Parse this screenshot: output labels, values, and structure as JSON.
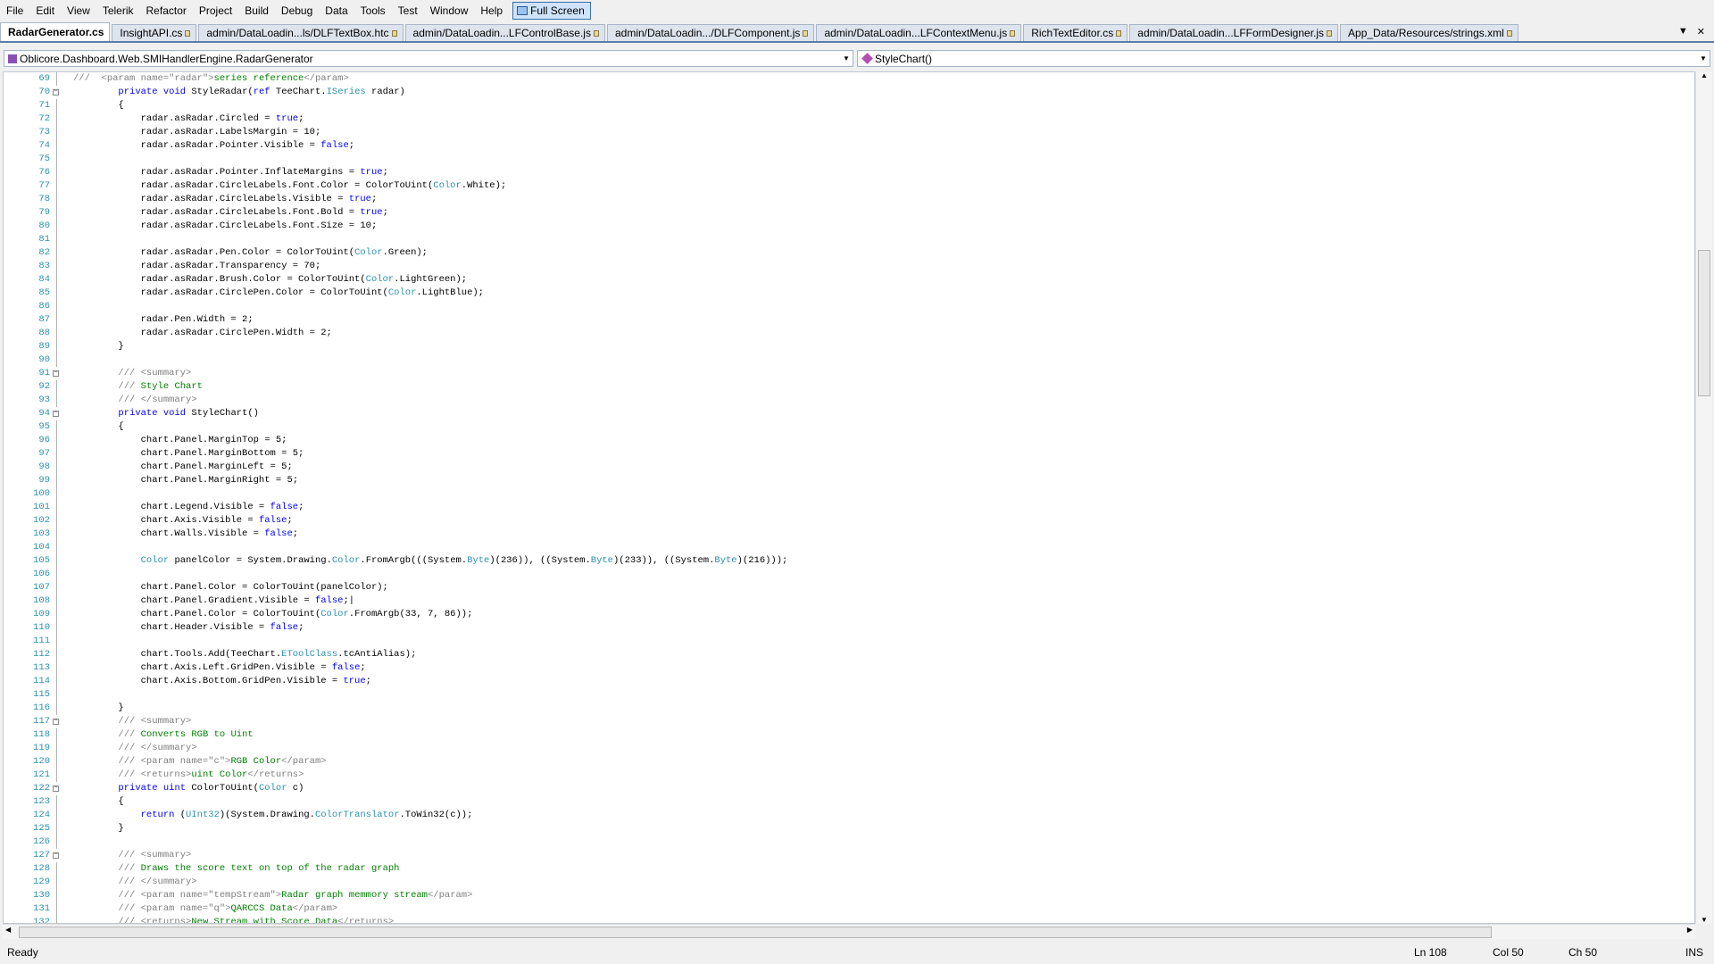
{
  "menu": [
    "File",
    "Edit",
    "View",
    "Telerik",
    "Refactor",
    "Project",
    "Build",
    "Debug",
    "Data",
    "Tools",
    "Test",
    "Window",
    "Help"
  ],
  "full_screen_label": "Full Screen",
  "tabs": [
    "RadarGenerator.cs",
    "InsightAPI.cs",
    "admin/DataLoadin...ls/DLFTextBox.htc",
    "admin/DataLoadin...LFControlBase.js",
    "admin/DataLoadin.../DLFComponent.js",
    "admin/DataLoadin...LFContextMenu.js",
    "RichTextEditor.cs",
    "admin/DataLoadin...LFFormDesigner.js",
    "App_Data/Resources/strings.xml"
  ],
  "active_tab": 0,
  "nav": {
    "type": "Oblicore.Dashboard.Web.SMIHandlerEngine.RadarGenerator",
    "member": "StyleChart()"
  },
  "editor": {
    "lines": [
      {
        "n": "69",
        "f": "",
        "t": [
          [
            "///  ",
            "cg"
          ],
          [
            "<param name=\"radar\">",
            "cg"
          ],
          [
            "series reference",
            "cm"
          ],
          [
            "</param>",
            "cg"
          ]
        ]
      },
      {
        "n": "70",
        "f": "-",
        "t": [
          [
            "        "
          ],
          [
            "private",
            "kw"
          ],
          [
            " "
          ],
          [
            "void",
            "kw"
          ],
          [
            " StyleRadar("
          ],
          [
            "ref",
            "kw"
          ],
          [
            " TeeChart."
          ],
          [
            "ISeries",
            "ty"
          ],
          [
            " radar)"
          ]
        ]
      },
      {
        "n": "71",
        "f": "",
        "t": [
          [
            "        {"
          ]
        ]
      },
      {
        "n": "72",
        "f": "",
        "t": [
          [
            "            radar.asRadar.Circled = "
          ],
          [
            "true",
            "kw"
          ],
          [
            ";"
          ]
        ]
      },
      {
        "n": "73",
        "f": "",
        "t": [
          [
            "            radar.asRadar.LabelsMargin = 10;"
          ]
        ]
      },
      {
        "n": "74",
        "f": "",
        "t": [
          [
            "            radar.asRadar.Pointer.Visible = "
          ],
          [
            "false",
            "kw"
          ],
          [
            ";"
          ]
        ]
      },
      {
        "n": "75",
        "f": "",
        "t": []
      },
      {
        "n": "76",
        "f": "",
        "t": [
          [
            "            radar.asRadar.Pointer.InflateMargins = "
          ],
          [
            "true",
            "kw"
          ],
          [
            ";"
          ]
        ]
      },
      {
        "n": "77",
        "f": "",
        "t": [
          [
            "            radar.asRadar.CircleLabels.Font.Color = ColorToUint("
          ],
          [
            "Color",
            "ty"
          ],
          [
            ".White);"
          ]
        ]
      },
      {
        "n": "78",
        "f": "",
        "t": [
          [
            "            radar.asRadar.CircleLabels.Visible = "
          ],
          [
            "true",
            "kw"
          ],
          [
            ";"
          ]
        ]
      },
      {
        "n": "79",
        "f": "",
        "t": [
          [
            "            radar.asRadar.CircleLabels.Font.Bold = "
          ],
          [
            "true",
            "kw"
          ],
          [
            ";"
          ]
        ]
      },
      {
        "n": "80",
        "f": "",
        "t": [
          [
            "            radar.asRadar.CircleLabels.Font.Size = 10;"
          ]
        ]
      },
      {
        "n": "81",
        "f": "",
        "t": []
      },
      {
        "n": "82",
        "f": "",
        "t": [
          [
            "            radar.asRadar.Pen.Color = ColorToUint("
          ],
          [
            "Color",
            "ty"
          ],
          [
            ".Green);"
          ]
        ]
      },
      {
        "n": "83",
        "f": "",
        "t": [
          [
            "            radar.asRadar.Transparency = 70;"
          ]
        ]
      },
      {
        "n": "84",
        "f": "",
        "t": [
          [
            "            radar.asRadar.Brush.Color = ColorToUint("
          ],
          [
            "Color",
            "ty"
          ],
          [
            ".LightGreen);"
          ]
        ]
      },
      {
        "n": "85",
        "f": "",
        "t": [
          [
            "            radar.asRadar.CirclePen.Color = ColorToUint("
          ],
          [
            "Color",
            "ty"
          ],
          [
            ".LightBlue);"
          ]
        ]
      },
      {
        "n": "86",
        "f": "",
        "t": []
      },
      {
        "n": "87",
        "f": "",
        "t": [
          [
            "            radar.Pen.Width = 2;"
          ]
        ]
      },
      {
        "n": "88",
        "f": "",
        "t": [
          [
            "            radar.asRadar.CirclePen.Width = 2;"
          ]
        ]
      },
      {
        "n": "89",
        "f": "",
        "t": [
          [
            "        }"
          ]
        ]
      },
      {
        "n": "90",
        "f": "",
        "t": []
      },
      {
        "n": "91",
        "f": "-",
        "t": [
          [
            "        "
          ],
          [
            "/// <summary>",
            "cg"
          ]
        ]
      },
      {
        "n": "92",
        "f": "",
        "t": [
          [
            "        "
          ],
          [
            "/// ",
            "cg"
          ],
          [
            "Style Chart",
            "cm"
          ]
        ]
      },
      {
        "n": "93",
        "f": "",
        "t": [
          [
            "        "
          ],
          [
            "/// </summary>",
            "cg"
          ]
        ]
      },
      {
        "n": "94",
        "f": "-",
        "t": [
          [
            "        "
          ],
          [
            "private",
            "kw"
          ],
          [
            " "
          ],
          [
            "void",
            "kw"
          ],
          [
            " StyleChart()"
          ]
        ]
      },
      {
        "n": "95",
        "f": "",
        "t": [
          [
            "        {"
          ]
        ]
      },
      {
        "n": "96",
        "f": "",
        "t": [
          [
            "            chart.Panel.MarginTop = 5;"
          ]
        ]
      },
      {
        "n": "97",
        "f": "",
        "t": [
          [
            "            chart.Panel.MarginBottom = 5;"
          ]
        ]
      },
      {
        "n": "98",
        "f": "",
        "t": [
          [
            "            chart.Panel.MarginLeft = 5;"
          ]
        ]
      },
      {
        "n": "99",
        "f": "",
        "t": [
          [
            "            chart.Panel.MarginRight = 5;"
          ]
        ]
      },
      {
        "n": "100",
        "f": "",
        "t": []
      },
      {
        "n": "101",
        "f": "",
        "t": [
          [
            "            chart.Legend.Visible = "
          ],
          [
            "false",
            "kw"
          ],
          [
            ";"
          ]
        ]
      },
      {
        "n": "102",
        "f": "",
        "t": [
          [
            "            chart.Axis.Visible = "
          ],
          [
            "false",
            "kw"
          ],
          [
            ";"
          ]
        ]
      },
      {
        "n": "103",
        "f": "",
        "t": [
          [
            "            chart.Walls.Visible = "
          ],
          [
            "false",
            "kw"
          ],
          [
            ";"
          ]
        ]
      },
      {
        "n": "104",
        "f": "",
        "t": []
      },
      {
        "n": "105",
        "f": "",
        "t": [
          [
            "            "
          ],
          [
            "Color",
            "ty"
          ],
          [
            " panelColor = System.Drawing."
          ],
          [
            "Color",
            "ty"
          ],
          [
            ".FromArgb(((System."
          ],
          [
            "Byte",
            "ty"
          ],
          [
            ")(236)), ((System."
          ],
          [
            "Byte",
            "ty"
          ],
          [
            ")(233)), ((System."
          ],
          [
            "Byte",
            "ty"
          ],
          [
            ")(216)));"
          ]
        ]
      },
      {
        "n": "106",
        "f": "",
        "t": []
      },
      {
        "n": "107",
        "f": "",
        "t": [
          [
            "            chart.Panel.Color = ColorToUint(panelColor);"
          ]
        ]
      },
      {
        "n": "108",
        "f": "",
        "t": [
          [
            "            chart.Panel.Gradient.Visible = "
          ],
          [
            "false",
            "kw"
          ],
          [
            ";|"
          ]
        ]
      },
      {
        "n": "109",
        "f": "",
        "t": [
          [
            "            chart.Panel.Color = ColorToUint("
          ],
          [
            "Color",
            "ty"
          ],
          [
            ".FromArgb(33, 7, 86));"
          ]
        ]
      },
      {
        "n": "110",
        "f": "",
        "t": [
          [
            "            chart.Header.Visible = "
          ],
          [
            "false",
            "kw"
          ],
          [
            ";"
          ]
        ]
      },
      {
        "n": "111",
        "f": "",
        "t": []
      },
      {
        "n": "112",
        "f": "",
        "t": [
          [
            "            chart.Tools.Add(TeeChart."
          ],
          [
            "EToolClass",
            "ty"
          ],
          [
            ".tcAntiAlias);"
          ]
        ]
      },
      {
        "n": "113",
        "f": "",
        "t": [
          [
            "            chart.Axis.Left.GridPen.Visible = "
          ],
          [
            "false",
            "kw"
          ],
          [
            ";"
          ]
        ]
      },
      {
        "n": "114",
        "f": "",
        "t": [
          [
            "            chart.Axis.Bottom.GridPen.Visible = "
          ],
          [
            "true",
            "kw"
          ],
          [
            ";"
          ]
        ]
      },
      {
        "n": "115",
        "f": "",
        "t": []
      },
      {
        "n": "116",
        "f": "",
        "t": [
          [
            "        }"
          ]
        ]
      },
      {
        "n": "117",
        "f": "-",
        "t": [
          [
            "        "
          ],
          [
            "/// <summary>",
            "cg"
          ]
        ]
      },
      {
        "n": "118",
        "f": "",
        "t": [
          [
            "        "
          ],
          [
            "/// ",
            "cg"
          ],
          [
            "Converts RGB to Uint",
            "cm"
          ]
        ]
      },
      {
        "n": "119",
        "f": "",
        "t": [
          [
            "        "
          ],
          [
            "/// </summary>",
            "cg"
          ]
        ]
      },
      {
        "n": "120",
        "f": "",
        "t": [
          [
            "        "
          ],
          [
            "/// <param name=\"c\">",
            "cg"
          ],
          [
            "RGB Color",
            "cm"
          ],
          [
            "</param>",
            "cg"
          ]
        ]
      },
      {
        "n": "121",
        "f": "",
        "t": [
          [
            "        "
          ],
          [
            "/// <returns>",
            "cg"
          ],
          [
            "uint Color",
            "cm"
          ],
          [
            "</returns>",
            "cg"
          ]
        ]
      },
      {
        "n": "122",
        "f": "-",
        "t": [
          [
            "        "
          ],
          [
            "private",
            "kw"
          ],
          [
            " "
          ],
          [
            "uint",
            "kw"
          ],
          [
            " ColorToUint("
          ],
          [
            "Color",
            "ty"
          ],
          [
            " c)"
          ]
        ]
      },
      {
        "n": "123",
        "f": "",
        "t": [
          [
            "        {"
          ]
        ]
      },
      {
        "n": "124",
        "f": "",
        "t": [
          [
            "            "
          ],
          [
            "return",
            "kw"
          ],
          [
            " ("
          ],
          [
            "UInt32",
            "ty"
          ],
          [
            ")(System.Drawing."
          ],
          [
            "ColorTranslator",
            "ty"
          ],
          [
            ".ToWin32(c));"
          ]
        ]
      },
      {
        "n": "125",
        "f": "",
        "t": [
          [
            "        }"
          ]
        ]
      },
      {
        "n": "126",
        "f": "",
        "t": []
      },
      {
        "n": "127",
        "f": "-",
        "t": [
          [
            "        "
          ],
          [
            "/// <summary>",
            "cg"
          ]
        ]
      },
      {
        "n": "128",
        "f": "",
        "t": [
          [
            "        "
          ],
          [
            "/// ",
            "cg"
          ],
          [
            "Draws the score text on top of the radar graph",
            "cm"
          ]
        ]
      },
      {
        "n": "129",
        "f": "",
        "t": [
          [
            "        "
          ],
          [
            "/// </summary>",
            "cg"
          ]
        ]
      },
      {
        "n": "130",
        "f": "",
        "t": [
          [
            "        "
          ],
          [
            "/// <param name=\"tempStream\">",
            "cg"
          ],
          [
            "Radar graph memmory stream",
            "cm"
          ],
          [
            "</param>",
            "cg"
          ]
        ]
      },
      {
        "n": "131",
        "f": "",
        "t": [
          [
            "        "
          ],
          [
            "/// <param name=\"q\">",
            "cg"
          ],
          [
            "QARCCS Data",
            "cm"
          ],
          [
            "</param>",
            "cg"
          ]
        ]
      },
      {
        "n": "132",
        "f": "",
        "t": [
          [
            "        "
          ],
          [
            "/// <returns>",
            "cg"
          ],
          [
            "New Stream with Score Data",
            "cm"
          ],
          [
            "</returns>",
            "cg"
          ]
        ]
      }
    ]
  },
  "status": {
    "ready": "Ready",
    "ln": "Ln 108",
    "col": "Col 50",
    "ch": "Ch 50",
    "ins": "INS"
  }
}
